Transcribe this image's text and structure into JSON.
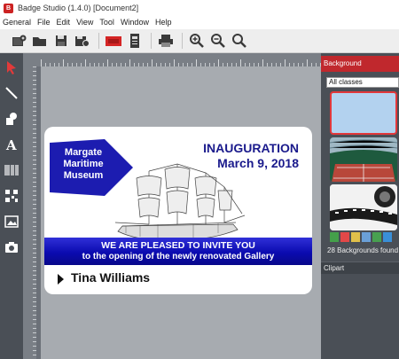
{
  "window": {
    "title": "Badge Studio (1.4.0) [Document2]"
  },
  "menu": {
    "items": [
      "General",
      "File",
      "Edit",
      "View",
      "Tool",
      "Window",
      "Help"
    ]
  },
  "toolbar": {
    "buttons": [
      "new-icon",
      "open-folder-icon",
      "save-icon",
      "save-as-icon",
      "print-preview-icon",
      "card-layout-icon",
      "printer-icon",
      "zoom-in-icon",
      "zoom-out-icon",
      "zoom-fit-icon"
    ]
  },
  "tools": [
    "select-arrow-icon",
    "line-icon",
    "shapes-icon",
    "text-icon",
    "barcode-icon",
    "qrcode-icon",
    "image-icon",
    "camera-icon"
  ],
  "badge": {
    "logo_line1": "Margate",
    "logo_line2": "Maritime",
    "logo_line3": "Museum",
    "event_title": "INAUGURATION",
    "event_date": "March 9, 2018",
    "invite_line1": "WE ARE PLEASED TO INVITE YOU",
    "invite_line2": "to the opening of the newly renovated Gallery",
    "attendee_name": "Tina Williams"
  },
  "right_panel": {
    "header": "Background",
    "class_select": "All classes",
    "backgrounds_found": "28 Backgrounds found",
    "clipart_header": "Clipart"
  },
  "colors": {
    "accent_red": "#c0282d",
    "badge_blue": "#0b0bb0",
    "title_blue": "#1a1a8c"
  }
}
